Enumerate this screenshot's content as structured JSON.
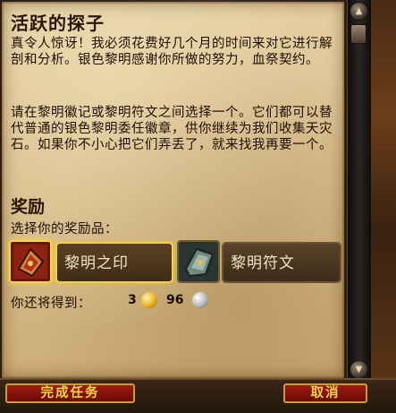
{
  "quest": {
    "title": "活跃的探子",
    "body": [
      "真令人惊讶！我必须花费好几个月的时间来对它进行解剖和分析。银色黎明感谢你所做的努力，血祭契约。",
      "请在黎明徽记或黎明符文之间选择一个。它们都可以替代普通的银色黎明委任徽章，供你继续为我们收集天灾石。如果你不小心把它们弄丢了，就来找我再要一个。"
    ]
  },
  "rewards": {
    "title": "奖励",
    "choose_label": "选择你的奖励品：",
    "items": [
      {
        "name": "黎明之印",
        "icon": "dawn-seal-icon",
        "selected": true
      },
      {
        "name": "黎明符文",
        "icon": "dawn-rune-icon",
        "selected": false
      }
    ],
    "money_label": "你还将得到：",
    "gold": "3",
    "silver": "96"
  },
  "buttons": {
    "complete": "完成任务",
    "cancel": "取消"
  },
  "colors": {
    "parchment": "#d9bf8e",
    "selected_border": "#f0d24c",
    "button_red": "#9d1a12",
    "button_text": "#f6d44a"
  }
}
